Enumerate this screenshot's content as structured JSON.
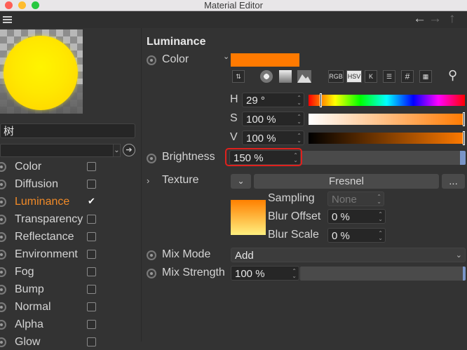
{
  "window": {
    "title": "Material Editor"
  },
  "traffic_lights": [
    "#fe5f57",
    "#febc2e",
    "#28c840"
  ],
  "left": {
    "name_value": "树",
    "channels": [
      {
        "label": "Color",
        "checked": false,
        "active": false
      },
      {
        "label": "Diffusion",
        "checked": false,
        "active": false
      },
      {
        "label": "Luminance",
        "checked": true,
        "active": true
      },
      {
        "label": "Transparency",
        "checked": false,
        "active": false
      },
      {
        "label": "Reflectance",
        "checked": false,
        "active": false
      },
      {
        "label": "Environment",
        "checked": false,
        "active": false
      },
      {
        "label": "Fog",
        "checked": false,
        "active": false
      },
      {
        "label": "Bump",
        "checked": false,
        "active": false
      },
      {
        "label": "Normal",
        "checked": false,
        "active": false
      },
      {
        "label": "Alpha",
        "checked": false,
        "active": false
      },
      {
        "label": "Glow",
        "checked": false,
        "active": false
      }
    ],
    "check_glyph": "✔"
  },
  "right": {
    "section_title": "Luminance",
    "color": {
      "label": "Color",
      "swatch": "#ff7a00",
      "mode_buttons": [
        "RGB",
        "HSV",
        "K"
      ],
      "h": {
        "label": "H",
        "value": "29 °"
      },
      "s": {
        "label": "S",
        "value": "100 %"
      },
      "v": {
        "label": "V",
        "value": "100 %"
      }
    },
    "brightness": {
      "label": "Brightness",
      "value": "150 %",
      "highlight": "#e0211d"
    },
    "texture": {
      "label": "Texture",
      "shader": "Fresnel",
      "more": "...",
      "sampling_label": "Sampling",
      "sampling_value": "None",
      "blur_offset_label": "Blur Offset",
      "blur_offset_value": "0 %",
      "blur_scale_label": "Blur Scale",
      "blur_scale_value": "0 %"
    },
    "mix_mode": {
      "label": "Mix Mode",
      "value": "Add"
    },
    "mix_strength": {
      "label": "Mix Strength",
      "value": "100 %"
    }
  }
}
